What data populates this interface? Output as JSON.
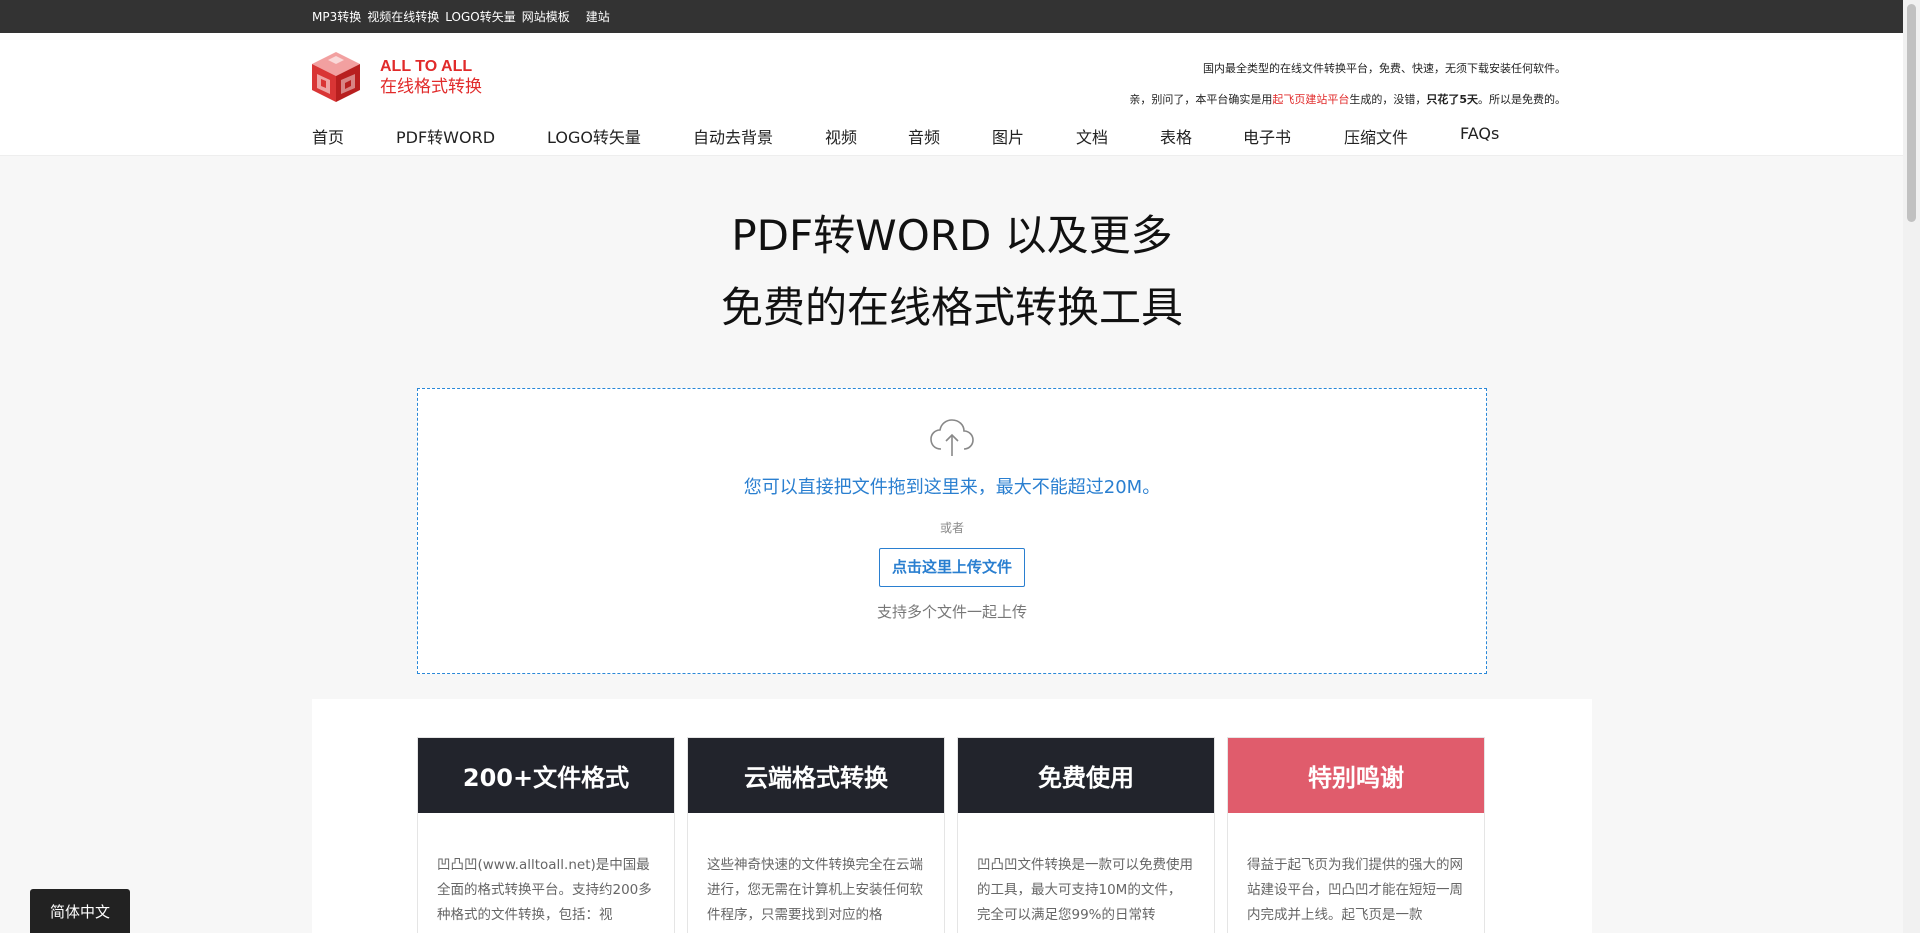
{
  "topbar": {
    "links": [
      "MP3转换",
      "视频在线转换",
      "LOGO转矢量",
      "网站模板"
    ],
    "extra": "建站"
  },
  "logo": {
    "en": "ALL TO ALL",
    "cn": "在线格式转换"
  },
  "notice": {
    "line1": "国内最全类型的在线文件转换平台，免费、快速，无须下载安装任何软件。",
    "line2_a": "亲，别问了，本平台确实是用",
    "line2_red": "起飞页建站平台",
    "line2_b": "生成的，没错，",
    "line2_bold": "只花了5天",
    "line2_c": "。所以是免费的。"
  },
  "nav": [
    "首页",
    "PDF转WORD",
    "LOGO转矢量",
    "自动去背景",
    "视频",
    "音频",
    "图片",
    "文档",
    "表格",
    "电子书",
    "压缩文件",
    "FAQs"
  ],
  "hero": {
    "line1": "PDF转WORD 以及更多",
    "line2": "免费的在线格式转换工具"
  },
  "upload": {
    "tip": "您可以直接把文件拖到这里来，最大不能超过20M。",
    "or": "或者",
    "button": "点击这里上传文件",
    "multi": "支持多个文件一起上传"
  },
  "features": [
    {
      "title": "200+文件格式",
      "text": "凹凸凹(www.alltoall.net)是中国最全面的格式转换平台。支持约200多种格式的文件转换，包括：视"
    },
    {
      "title": "云端格式转换",
      "text": "这些神奇快速的文件转换完全在云端进行，您无需在计算机上安装任何软件程序，只需要找到对应的格"
    },
    {
      "title": "免费使用",
      "text": "凹凸凹文件转换是一款可以免费使用的工具，最大可支持10M的文件，完全可以满足您99%的日常转"
    },
    {
      "title": "特别鸣谢",
      "text": "得益于起飞页为我们提供的强大的网站建设平台，凹凸凹才能在短短一周内完成并上线。起飞页是一款"
    }
  ],
  "lang": "简体中文",
  "colors": {
    "accent": "#2a7fd0",
    "brand": "#e12a2a",
    "dark": "#22242c",
    "pink": "#e05c6c"
  }
}
